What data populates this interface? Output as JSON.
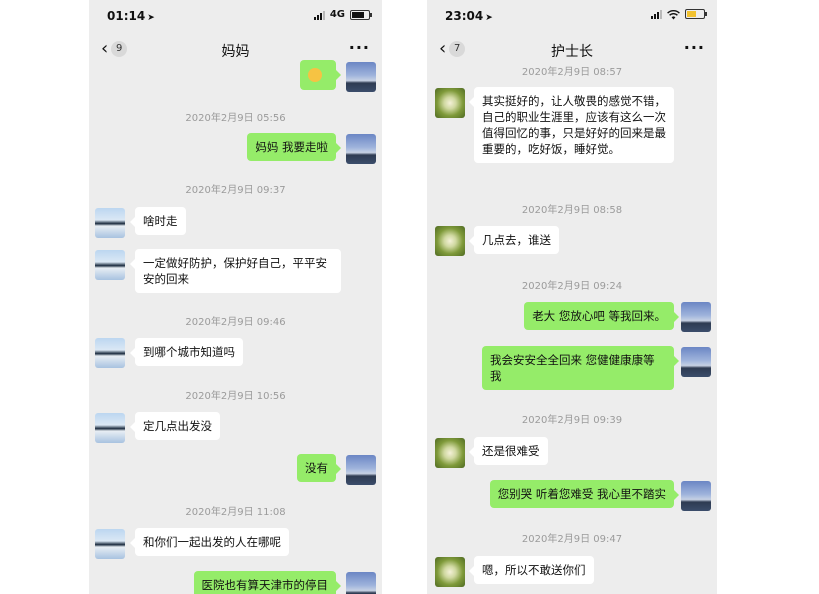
{
  "left_phone": {
    "status": {
      "time": "01:14",
      "network": "4G"
    },
    "nav": {
      "back_count": "9",
      "title": "妈妈"
    },
    "messages": [
      {
        "type": "outgoing",
        "text": "😂"
      },
      {
        "type": "timestamp",
        "text": "2020年2月9日 05:56"
      },
      {
        "type": "outgoing",
        "text": "妈妈 我要走啦"
      },
      {
        "type": "timestamp",
        "text": "2020年2月9日 09:37"
      },
      {
        "type": "incoming",
        "text": "啥时走"
      },
      {
        "type": "incoming",
        "text": "一定做好防护，保护好自己，平平安安的回来"
      },
      {
        "type": "timestamp",
        "text": "2020年2月9日 09:46"
      },
      {
        "type": "incoming",
        "text": "到哪个城市知道吗"
      },
      {
        "type": "timestamp",
        "text": "2020年2月9日 10:56"
      },
      {
        "type": "incoming",
        "text": "定几点出发没"
      },
      {
        "type": "outgoing",
        "text": "没有"
      },
      {
        "type": "timestamp",
        "text": "2020年2月9日 11:08"
      },
      {
        "type": "incoming",
        "text": "和你们一起出发的人在哪呢"
      },
      {
        "type": "outgoing",
        "text": "医院也有算天津市的停目"
      }
    ]
  },
  "right_phone": {
    "status": {
      "time": "23:04"
    },
    "nav": {
      "back_count": "7",
      "title": "护士长"
    },
    "messages": [
      {
        "type": "timestamp",
        "text": "2020年2月9日 08:57"
      },
      {
        "type": "incoming",
        "text": "其实挺好的，让人敬畏的感觉不错，自己的职业生涯里，应该有这么一次值得回忆的事，只是好好的回来是最重要的，吃好饭，睡好觉。"
      },
      {
        "type": "timestamp",
        "text": "2020年2月9日 08:58"
      },
      {
        "type": "incoming",
        "text": "几点去，谁送"
      },
      {
        "type": "timestamp",
        "text": "2020年2月9日 09:24"
      },
      {
        "type": "outgoing",
        "text": "老大 您放心吧 等我回来。"
      },
      {
        "type": "outgoing",
        "text": "我会安安全全回来 您健健康康等我"
      },
      {
        "type": "timestamp",
        "text": "2020年2月9日 09:39"
      },
      {
        "type": "incoming",
        "text": "还是很难受"
      },
      {
        "type": "outgoing",
        "text": "您别哭 听着您难受 我心里不踏实"
      },
      {
        "type": "timestamp",
        "text": "2020年2月9日 09:47"
      },
      {
        "type": "incoming",
        "text": "嗯，所以不敢送你们"
      }
    ]
  },
  "colors": {
    "chat_bg": "#ededed",
    "outgoing_bubble": "#95ec69",
    "incoming_bubble": "#ffffff",
    "timestamp": "#9b9b9b"
  },
  "icons": [
    "back-chevron-icon",
    "more-dots-icon",
    "location-arrow-icon",
    "signal-icon",
    "wifi-icon",
    "battery-icon",
    "laughing-emoji-icon"
  ]
}
